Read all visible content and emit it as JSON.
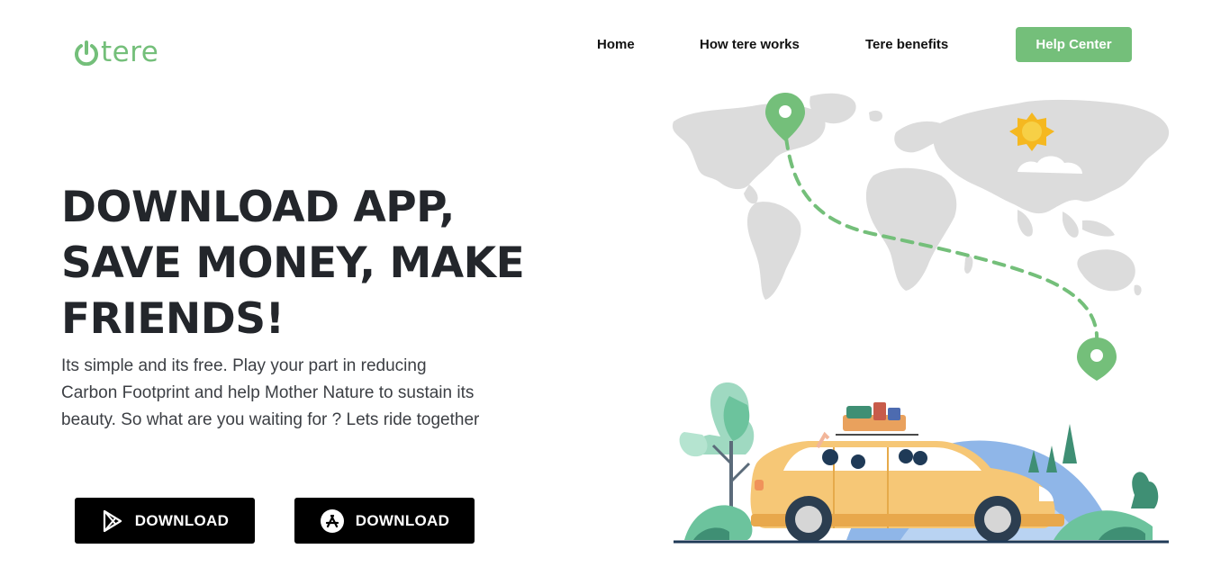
{
  "brand": {
    "name": "tere",
    "color": "#74bf7a"
  },
  "nav": {
    "items": [
      "Home",
      "How tere works",
      "Tere benefits"
    ],
    "cta": "Help Center"
  },
  "hero": {
    "title_lines": [
      "DOWNLOAD APP,",
      "SAVE MONEY, MAKE",
      "FRIENDS!"
    ],
    "description": "Its simple and its free. Play your part in reducing Carbon Footprint and help Mother Nature to sustain its beauty. So what are you waiting for ? Lets ride together"
  },
  "downloads": [
    {
      "icon": "google-play-icon",
      "label": "DOWNLOAD"
    },
    {
      "icon": "app-store-icon",
      "label": "DOWNLOAD"
    }
  ],
  "illustration": {
    "subject": "world-map-route-car-trip",
    "icons": [
      "map-pin-icon",
      "sun-icon",
      "car-icon"
    ]
  },
  "colors": {
    "accent": "#74bf7a",
    "button_dark": "#000000",
    "heading": "#23262b",
    "car": "#f6c776",
    "map": "#dcdcdc"
  }
}
